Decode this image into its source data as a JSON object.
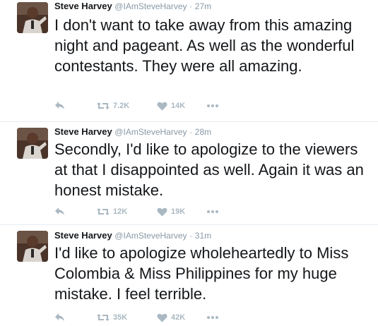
{
  "colors": {
    "name": "#14171a",
    "meta": "#8899a6",
    "action_gray": "#aab8c2"
  },
  "tweets": [
    {
      "name": "Steve Harvey",
      "handle": "@IAmSteveHarvey",
      "separator": "·",
      "time": "27m",
      "text": "I don't want to take away from this amazing night and pageant. As well as the wonderful contestants. They were all amazing.",
      "retweets": "7.2K",
      "likes": "14K",
      "icons": [
        "reply-icon",
        "retweet-icon",
        "heart-icon",
        "more-icon"
      ]
    },
    {
      "name": "Steve Harvey",
      "handle": "@IAmSteveHarvey",
      "separator": "·",
      "time": "28m",
      "text": "Secondly, I'd like to apologize to the viewers at that I disappointed as well. Again it was an honest mistake.",
      "retweets": "12K",
      "likes": "19K",
      "icons": [
        "reply-icon",
        "retweet-icon",
        "heart-icon",
        "more-icon"
      ]
    },
    {
      "name": "Steve Harvey",
      "handle": "@IAmSteveHarvey",
      "separator": "·",
      "time": "31m",
      "text": "I'd like to apologize wholeheartedly to Miss Colombia & Miss Philippines for my huge mistake. I feel terrible.",
      "retweets": "35K",
      "likes": "42K",
      "icons": [
        "reply-icon",
        "retweet-icon",
        "heart-icon",
        "more-icon"
      ]
    }
  ]
}
